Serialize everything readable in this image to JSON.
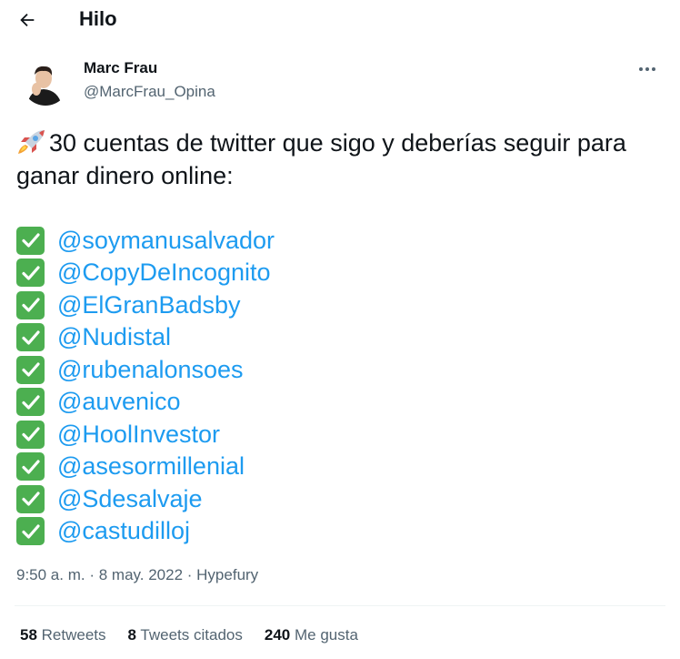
{
  "header": {
    "title": "Hilo",
    "back_icon": "arrow-left-icon"
  },
  "tweet": {
    "author": {
      "name": "Marc Frau",
      "handle": "@MarcFrau_Opina"
    },
    "intro_emoji": "rocket-icon",
    "intro_text": "30 cuentas de twitter que sigo y deberías seguir para ganar dinero online:",
    "list_icon": "check-mark-button-icon",
    "mentions": [
      "@soymanusalvador",
      "@CopyDeIncognito",
      "@ElGranBadsby",
      "@Nudistal",
      "@rubenalonsoes",
      "@auvenico",
      "@HoolInvestor",
      "@asesormillenial",
      "@Sdesalvaje",
      "@castudilloj"
    ],
    "time": "9:50 a. m.",
    "separator": "·",
    "date": "8 may. 2022",
    "source": "Hypefury"
  },
  "stats": {
    "retweets_count": "58",
    "retweets_label": "Retweets",
    "quotes_count": "8",
    "quotes_label": "Tweets citados",
    "likes_count": "240",
    "likes_label": "Me gusta"
  },
  "colors": {
    "link": "#1d9bf0",
    "text": "#0f1419",
    "secondary": "#536471",
    "check": "#4caf50"
  }
}
